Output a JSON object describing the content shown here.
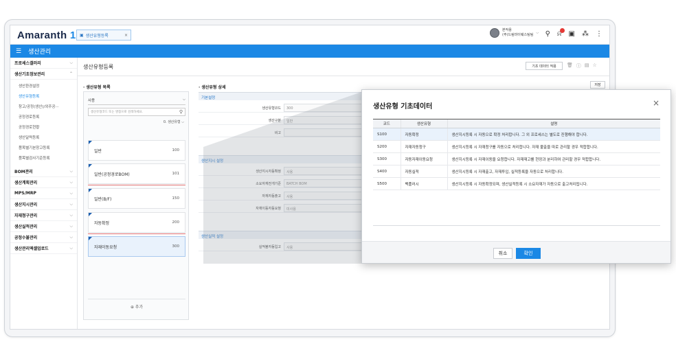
{
  "app": {
    "logo_text": "Amaranth",
    "logo_version": "10"
  },
  "tab": {
    "label": "생산유형등록",
    "close": "×"
  },
  "user": {
    "name": "본작용",
    "dept": "(주)드림마이웨스팅팀"
  },
  "nav": {
    "menu_title": "생산관리"
  },
  "sidebar": {
    "groups": [
      {
        "label": "프로세스갤러리",
        "expanded": false
      },
      {
        "label": "생산기초정보관리",
        "expanded": true,
        "items": [
          "생산환경설정",
          "생산유형등록",
          "창고/공정(생산)/외주공···",
          "공정경로등록",
          "공정경로현황",
          "생산달력등록",
          "품목별기본창고등록",
          "품목별검사기준등록"
        ],
        "active": "생산유형등록"
      },
      {
        "label": "BOM관리"
      },
      {
        "label": "생산계획관리"
      },
      {
        "label": "MPS/MRP"
      },
      {
        "label": "생산지시관리"
      },
      {
        "label": "자재청구관리"
      },
      {
        "label": "생산실적관리"
      },
      {
        "label": "공정수불관리"
      },
      {
        "label": "생산관리엑셀업로드"
      }
    ]
  },
  "page": {
    "title": "생산유형등록",
    "basic_data_button": "기초 데이터 적용",
    "save_button": "저장"
  },
  "list_panel": {
    "title": "생산유형 목록",
    "select_value": "사용",
    "search_placeholder": "생산유형코드 또는 명칭으로 검색하세요.",
    "sort_label": "0. 생산유형",
    "items": [
      {
        "name": "일반",
        "code": "100"
      },
      {
        "name": "일반(공정경로BOM)",
        "code": "101"
      },
      {
        "name": "일반(B/F)",
        "code": "150"
      },
      {
        "name": "자동확정",
        "code": "200"
      },
      {
        "name": "자재이동요청",
        "code": "300"
      }
    ],
    "add_label": "⊕ 추가"
  },
  "detail": {
    "title": "생산유형 상세",
    "sections": [
      {
        "header": "기본설정",
        "fields": [
          {
            "label": "생산유형코드",
            "value": "300"
          },
          {
            "label": "생산구분",
            "value": "일반"
          },
          {
            "label": "비고",
            "value": ""
          }
        ]
      },
      {
        "header": "생산지시 설정",
        "fields": [
          {
            "label": "생산지시자동확정",
            "value": "사용"
          },
          {
            "label": "소요자재전개기준",
            "value": "BATCH BOM"
          },
          {
            "label": "자재자동출고",
            "value": "사용"
          },
          {
            "label": "자재이동자동요청",
            "value": "미사용"
          }
        ]
      },
      {
        "header": "생산실적 설정",
        "fields": [
          {
            "label": "실적불자동입고",
            "value": "사용"
          }
        ]
      }
    ]
  },
  "popup": {
    "title": "생산유형 기초데이터",
    "close": "×",
    "columns": [
      "코드",
      "생산유형",
      "설명"
    ],
    "rows": [
      [
        "S100",
        "자동확정",
        "생산지시등록 시 자동으로 확정 처리합니다. 그 외 프로세스는 별도로 진행해야 합니다."
      ],
      [
        "S200",
        "자재자동청구",
        "생산지시등록 시 자재청구를 자동으로 처리합니다. 자재 불출을 따로 관리할 경우 적합합니다."
      ],
      [
        "S300",
        "자동자재이동요청",
        "생산지시등록 시 자재이동을 요청합니다. 자재재고를 현장과 분리하여 관리할 경우 적합합니다."
      ],
      [
        "S400",
        "자동실적",
        "생산지시등록 시 자재출고, 자재투입, 실적등록을 자동으로 처리합니다."
      ],
      [
        "S500",
        "백플러시",
        "생산지시등록 시 자동확정되며, 생산실적등록 시 소요자재가 자동으로 출고처리됩니다."
      ]
    ],
    "cancel": "취소",
    "confirm": "확인"
  }
}
